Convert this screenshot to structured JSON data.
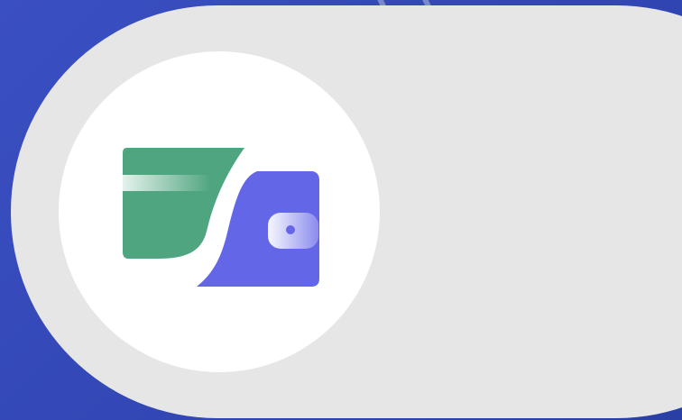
{
  "app": {
    "name": "",
    "logo_icon": "card-and-wallet-logo-icon"
  },
  "colors": {
    "background_blue": "#3246b4",
    "pill_gray": "#e6e6e7",
    "circle_white": "#ffffff",
    "card_green": "#4fa57f",
    "wallet_purple": "#6466e8"
  }
}
